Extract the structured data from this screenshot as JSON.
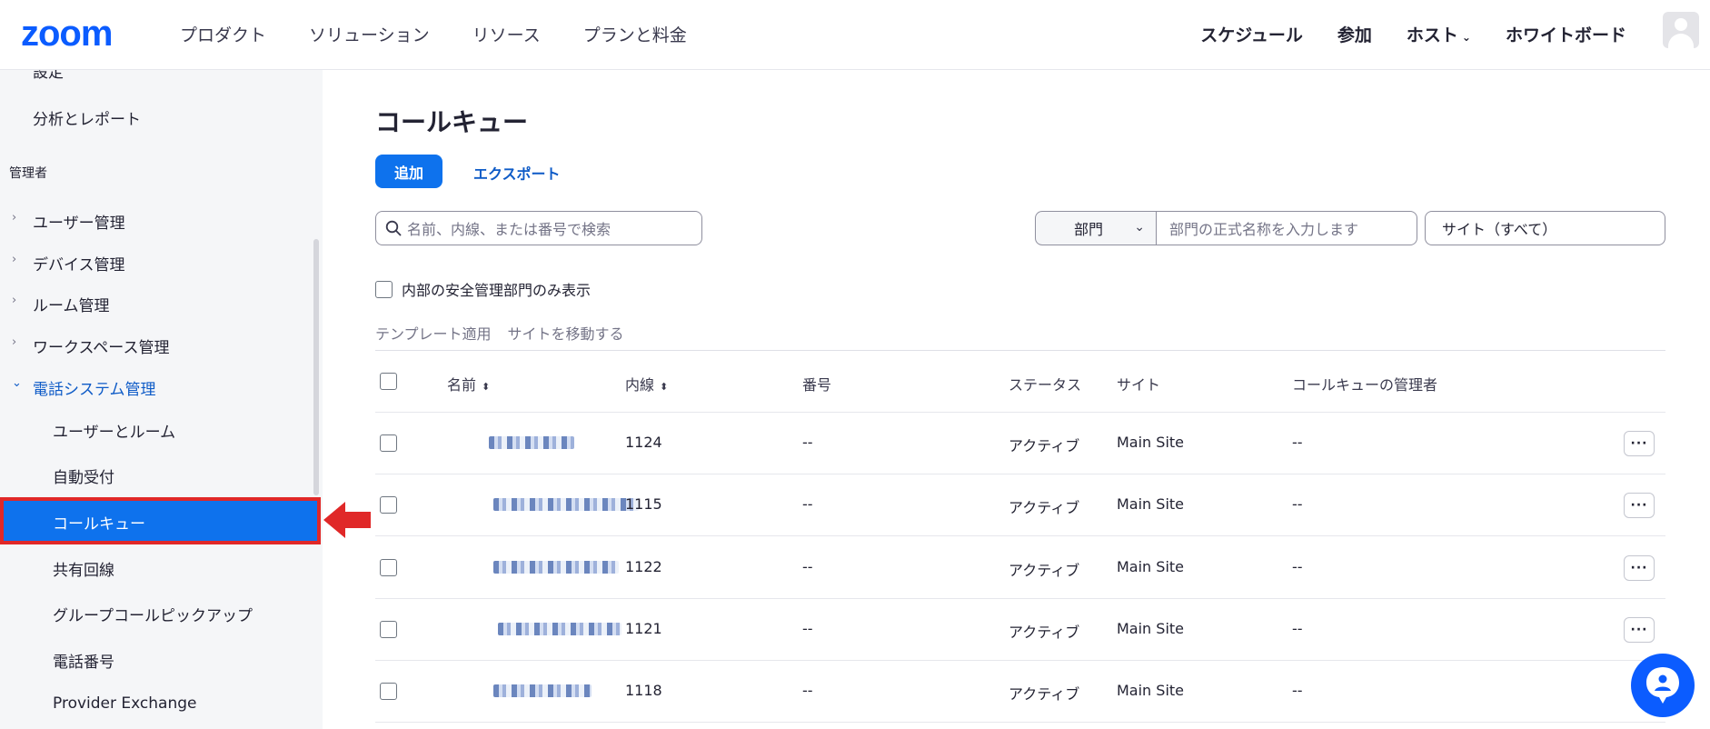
{
  "header": {
    "logo": "zoom",
    "nav_left": [
      "プロダクト",
      "ソリューション",
      "リソース",
      "プランと料金"
    ],
    "nav_right": {
      "schedule": "スケジュール",
      "join": "参加",
      "host": "ホスト",
      "whiteboard": "ホワイトボード"
    }
  },
  "sidebar": {
    "top_items": [
      "設定",
      "分析とレポート"
    ],
    "admin_section": "管理者",
    "groups": [
      "ユーザー管理",
      "デバイス管理",
      "ルーム管理",
      "ワークスペース管理",
      "電話システム管理"
    ],
    "phone_items": [
      "ユーザーとルーム",
      "自動受付",
      "コールキュー",
      "共有回線",
      "グループコールピックアップ",
      "電話番号",
      "Provider Exchange"
    ],
    "active_item": "コールキュー"
  },
  "main": {
    "title": "コールキュー",
    "add_label": "追加",
    "export_label": "エクスポート",
    "search_placeholder": "名前、内線、または番号で検索",
    "dept_select": "部門",
    "dept_placeholder": "部門の正式名称を入力します",
    "site_select": "サイト（すべて）",
    "secure_filter_label": "内部の安全管理部門のみ表示",
    "bulk_actions": [
      "テンプレート適用",
      "サイトを移動する"
    ],
    "columns": {
      "name": "名前",
      "extension": "内線",
      "number": "番号",
      "status": "ステータス",
      "site": "サイト",
      "managers": "コールキューの管理者"
    },
    "rows": [
      {
        "extension": "1124",
        "number": "--",
        "status": "アクティブ",
        "site": "Main Site",
        "managers": "--"
      },
      {
        "extension": "1115",
        "number": "--",
        "status": "アクティブ",
        "site": "Main Site",
        "managers": "--"
      },
      {
        "extension": "1122",
        "number": "--",
        "status": "アクティブ",
        "site": "Main Site",
        "managers": "--"
      },
      {
        "extension": "1121",
        "number": "--",
        "status": "アクティブ",
        "site": "Main Site",
        "managers": "--"
      },
      {
        "extension": "1118",
        "number": "--",
        "status": "アクティブ",
        "site": "Main Site",
        "managers": "--"
      }
    ],
    "more_label": "···"
  },
  "colors": {
    "brand": "#0b5cff",
    "active_bg": "#0e72ed",
    "highlight_red": "#e02828"
  }
}
